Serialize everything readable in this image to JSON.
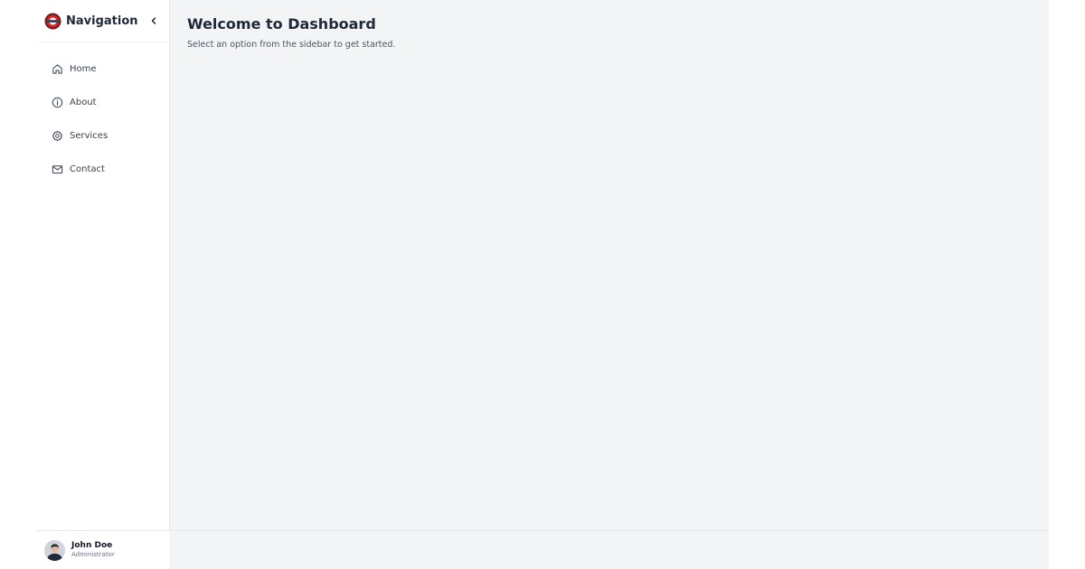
{
  "sidebar": {
    "brand": "Navigation",
    "items": [
      {
        "label": "Home",
        "icon": "home-icon"
      },
      {
        "label": "About",
        "icon": "info-icon"
      },
      {
        "label": "Services",
        "icon": "gear-icon"
      },
      {
        "label": "Contact",
        "icon": "mail-icon"
      }
    ],
    "user": {
      "name": "John Doe",
      "role": "Administrator"
    }
  },
  "main": {
    "title": "Welcome to Dashboard",
    "subtitle": "Select an option from the sidebar to get started."
  },
  "colors": {
    "sidebar_bg": "#ffffff",
    "main_bg": "#f3f4f6",
    "text_primary": "#1f2937",
    "text_secondary": "#4b5563",
    "border": "#e5e7eb",
    "logo_accent": "#b91c1c"
  }
}
